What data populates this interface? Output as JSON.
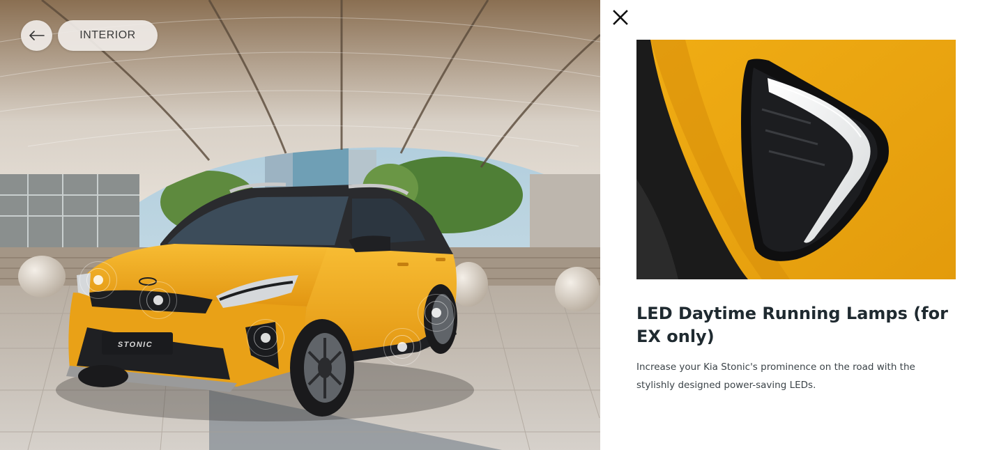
{
  "scene": {
    "badge_text": "STONIC",
    "back_icon": "arrow-left-icon",
    "interior_label": "INTERIOR"
  },
  "hotspots": [
    {
      "name": "hotspot-headlamp-left"
    },
    {
      "name": "hotspot-grille"
    },
    {
      "name": "hotspot-fog-lamp"
    },
    {
      "name": "hotspot-front-wheel"
    },
    {
      "name": "hotspot-rear-wheel"
    }
  ],
  "panel": {
    "close_icon": "close-icon",
    "title": "LED Daytime Running Lamps (for EX only)",
    "description": "Increase your Kia Stonic's prominence on the road with the stylishly designed power-saving LEDs."
  },
  "colors": {
    "car_body": "#f0a81c",
    "title_text": "#1f2a30",
    "body_text": "#3b4348"
  }
}
